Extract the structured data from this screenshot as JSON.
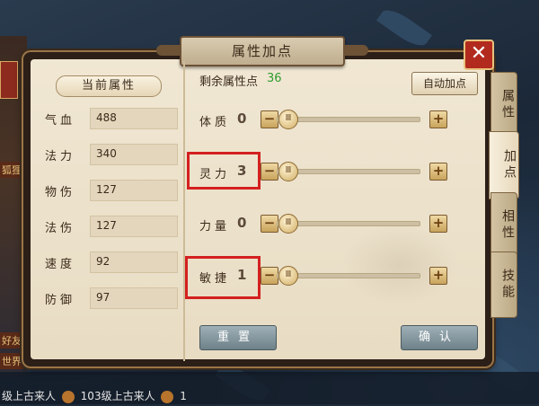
{
  "dialog": {
    "title": "属性加点",
    "close_symbol": "✕"
  },
  "current_attributes": {
    "header": "当前属性",
    "stats": [
      {
        "label": "气血",
        "value": "488"
      },
      {
        "label": "法力",
        "value": "340"
      },
      {
        "label": "物伤",
        "value": "127"
      },
      {
        "label": "法伤",
        "value": "127"
      },
      {
        "label": "速度",
        "value": "92"
      },
      {
        "label": "防御",
        "value": "97"
      }
    ]
  },
  "allocation": {
    "remaining_label": "剩余属性点",
    "remaining_value": "36",
    "auto_button": "自动加点",
    "rows": [
      {
        "label": "体质",
        "value": "0",
        "minus": "−",
        "plus": "+",
        "knob": "Ⅲ",
        "highlighted": false
      },
      {
        "label": "灵力",
        "value": "3",
        "minus": "−",
        "plus": "+",
        "knob": "Ⅲ",
        "highlighted": true
      },
      {
        "label": "力量",
        "value": "0",
        "minus": "−",
        "plus": "+",
        "knob": "Ⅲ",
        "highlighted": false
      },
      {
        "label": "敏捷",
        "value": "1",
        "minus": "−",
        "plus": "+",
        "knob": "Ⅲ",
        "highlighted": true
      }
    ],
    "reset_button": "重置",
    "confirm_button": "确认"
  },
  "side_tabs": [
    {
      "label": "属性",
      "active": false
    },
    {
      "label": "加点",
      "active": true
    },
    {
      "label": "相性",
      "active": false
    },
    {
      "label": "技能",
      "active": false
    }
  ],
  "background": {
    "left_labels": [
      "狐狸",
      "好友",
      "世界"
    ],
    "chat_line_a": "级上古来人",
    "chat_line_b": "103级上古来人",
    "chat_line_c": "1"
  },
  "colors": {
    "remaining_points": "#2e9c2e",
    "highlight_box": "#d42020",
    "close_button": "#b22a1e"
  }
}
